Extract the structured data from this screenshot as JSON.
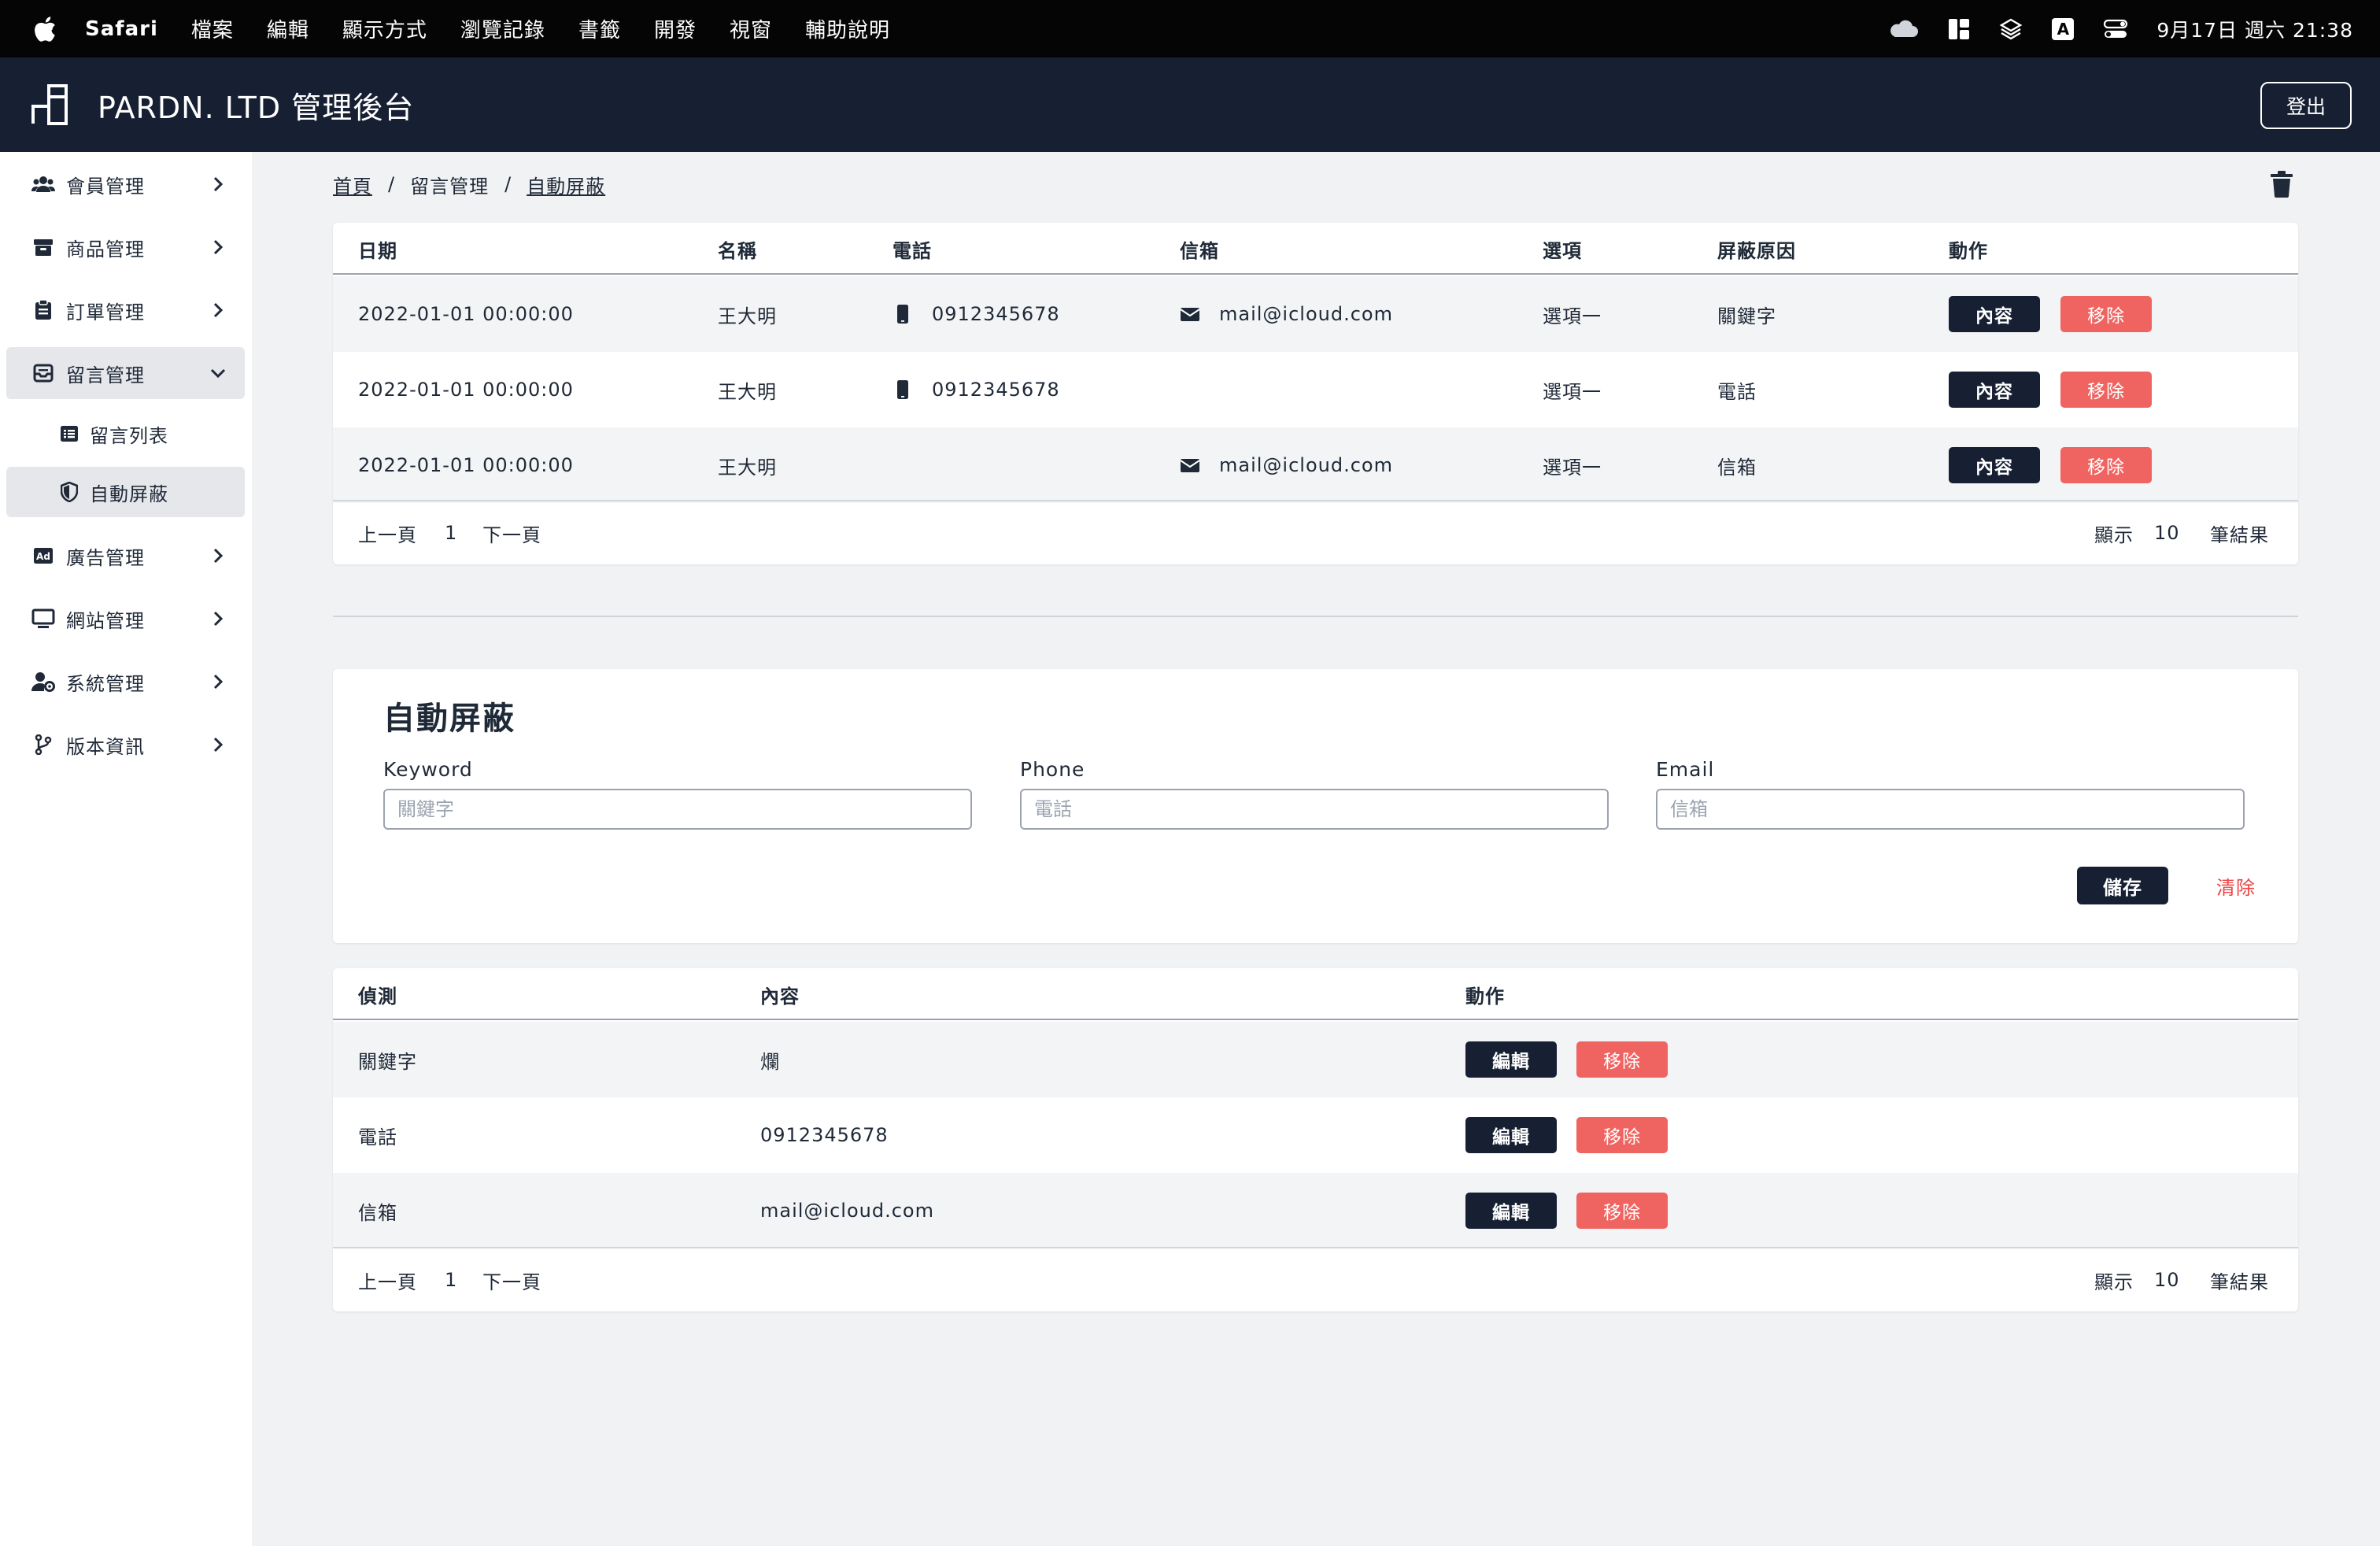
{
  "menubar": {
    "app_name": "Safari",
    "items": [
      "檔案",
      "編輯",
      "顯示方式",
      "瀏覽記錄",
      "書籤",
      "開發",
      "視窗",
      "輔助說明"
    ],
    "input_indicator": "A",
    "clock": "9月17日 週六 21:38"
  },
  "header": {
    "title": "PARDN. LTD 管理後台",
    "logout_label": "登出"
  },
  "sidebar": {
    "items": [
      {
        "label": "會員管理",
        "icon": "users-icon"
      },
      {
        "label": "商品管理",
        "icon": "box-icon"
      },
      {
        "label": "訂單管理",
        "icon": "clipboard-icon"
      },
      {
        "label": "留言管理",
        "icon": "inbox-icon",
        "expanded": true
      },
      {
        "label": "廣告管理",
        "icon": "ad-icon"
      },
      {
        "label": "網站管理",
        "icon": "monitor-icon"
      },
      {
        "label": "系統管理",
        "icon": "user-gear-icon"
      },
      {
        "label": "版本資訊",
        "icon": "code-branch-icon"
      }
    ],
    "subitems": [
      {
        "label": "留言列表",
        "icon": "list-icon"
      },
      {
        "label": "自動屏蔽",
        "icon": "shield-icon",
        "active": true
      }
    ]
  },
  "breadcrumb": {
    "home": "首頁",
    "parent": "留言管理",
    "current": "自動屏蔽",
    "separator": "/"
  },
  "blocked_table": {
    "columns": [
      "日期",
      "名稱",
      "電話",
      "信箱",
      "選項",
      "屏蔽原因",
      "動作"
    ],
    "rows": [
      {
        "date": "2022-01-01 00:00:00",
        "name": "王大明",
        "phone": "0912345678",
        "email": "mail@icloud.com",
        "option": "選項一",
        "reason": "關鍵字"
      },
      {
        "date": "2022-01-01 00:00:00",
        "name": "王大明",
        "phone": "0912345678",
        "email": "",
        "option": "選項一",
        "reason": "電話"
      },
      {
        "date": "2022-01-01 00:00:00",
        "name": "王大明",
        "phone": "",
        "email": "mail@icloud.com",
        "option": "選項一",
        "reason": "信箱"
      }
    ],
    "content_label": "內容",
    "remove_label": "移除",
    "pager": {
      "prev": "上一頁",
      "page": "1",
      "next": "下一頁",
      "show": "顯示",
      "per_page": "10",
      "results": "筆結果"
    }
  },
  "form": {
    "title": "自動屏蔽",
    "keyword_label": "Keyword",
    "keyword_placeholder": "關鍵字",
    "phone_label": "Phone",
    "phone_placeholder": "電話",
    "email_label": "Email",
    "email_placeholder": "信箱",
    "save_label": "儲存",
    "clear_label": "清除"
  },
  "rules_table": {
    "columns": [
      "偵測",
      "內容",
      "動作"
    ],
    "rows": [
      {
        "type": "關鍵字",
        "content": "爛"
      },
      {
        "type": "電話",
        "content": "0912345678"
      },
      {
        "type": "信箱",
        "content": "mail@icloud.com"
      }
    ],
    "edit_label": "編輯",
    "remove_label": "移除",
    "pager": {
      "prev": "上一頁",
      "page": "1",
      "next": "下一頁",
      "show": "顯示",
      "per_page": "10",
      "results": "筆結果"
    }
  },
  "colors": {
    "navy": "#172033",
    "danger": "#ef6461",
    "clear_text": "#ef4444",
    "row_stripe": "#f3f4f6",
    "page_bg": "#f1f2f4"
  }
}
